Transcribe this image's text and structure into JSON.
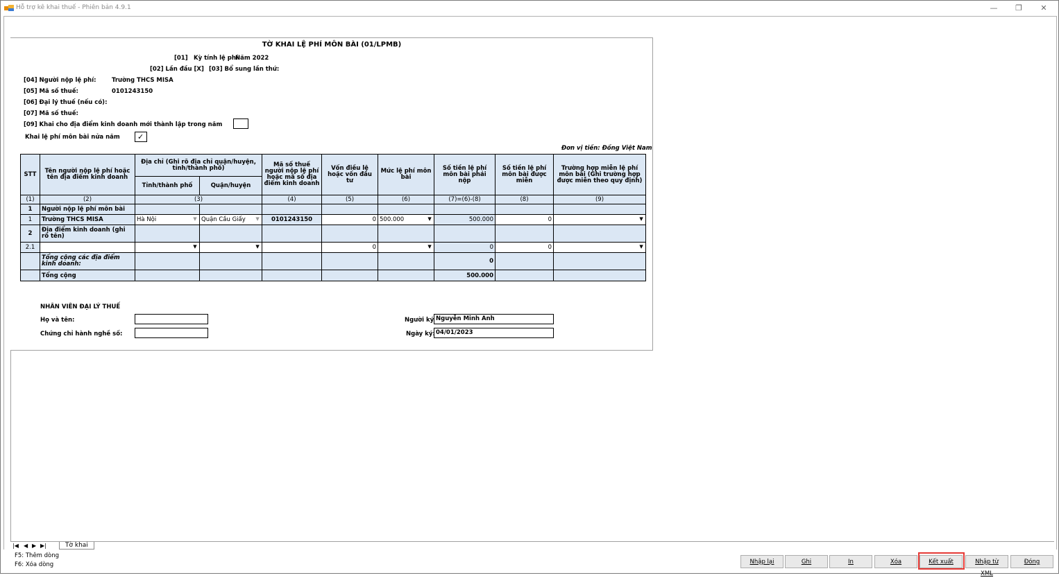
{
  "window": {
    "title": "Hỗ trợ kê khai thuế - Phiên bản 4.9.1",
    "minimize": "—",
    "restore": "❐",
    "close": "✕"
  },
  "form": {
    "title": "TỜ KHAI LỆ PHÍ MÔN BÀI (01/LPMB)",
    "period_code": "[01]",
    "period_label": "Kỳ tính lệ phí:",
    "period_value": "Năm 2022",
    "first_time": "[02] Lần đầu [X]",
    "supplement": "[03] Bổ sung lần thứ:",
    "payer_label": "[04] Người nộp lệ phí:",
    "payer_value": "Trường THCS MISA",
    "tax_code_label": "[05] Mã số thuế:",
    "tax_code_value": "0101243150",
    "agent_label": "[06] Đại lý thuế (nếu có):",
    "agent_tax_label": "[07] Mã số thuế:",
    "new_location_label": "[09] Khai cho địa điểm kinh doanh mới thành lập trong năm",
    "half_year_label": "Khai lệ phí môn bài nửa năm",
    "currency_note": "Đơn vị tiền: Đồng Việt Nam"
  },
  "table": {
    "headers": {
      "stt": "STT",
      "name": "Tên người nộp lệ phí hoặc tên địa điểm kinh doanh",
      "address": "Địa chỉ (Ghi rõ địa chỉ quận/huyện, tỉnh/thành phố)",
      "province": "Tỉnh/thành phố",
      "district": "Quận/huyện",
      "taxcode": "Mã số thuế người nộp lệ phí hoặc mã số địa điểm kinh doanh",
      "capital": "Vốn điều lệ hoặc vốn đầu tư",
      "fee_level": "Mức lệ phí môn bài",
      "payable": "Số tiền lệ phí môn bài phải nộp",
      "exempt": "Số tiền lệ phí môn bài được miễn",
      "exempt_case": "Trường hợp miễn lệ phí môn bài (Ghi trường hợp được miễn theo quy định)"
    },
    "index_row": [
      "(1)",
      "(2)",
      "(3)",
      "(4)",
      "(5)",
      "(6)",
      "(7)=(6)-(8)",
      "(8)",
      "(9)"
    ],
    "section1_no": "1",
    "section1_label": "Người nộp lệ phí môn bài",
    "row1": {
      "no": "1",
      "name": "Trường THCS MISA",
      "province": "Hà Nội",
      "district": "Quận Cầu Giấy",
      "taxcode": "0101243150",
      "capital": "0",
      "fee_level": "500.000",
      "payable": "500.000",
      "exempt": "0",
      "exempt_case": ""
    },
    "section2_no": "2",
    "section2_label": "Địa điểm kinh doanh (ghi rõ tên)",
    "row21": {
      "no": "2.1",
      "capital": "0",
      "payable": "0",
      "exempt": "0"
    },
    "subtotal_label": "Tổng cộng các địa điểm kinh doanh:",
    "subtotal_value": "0",
    "total_label": "Tổng cộng",
    "total_value": "500.000"
  },
  "agent_staff": {
    "heading": "NHÂN VIÊN ĐẠI LÝ THUẾ",
    "name_label": "Họ và tên:",
    "cert_label": "Chứng chỉ hành nghề số:",
    "signer_label": "Người ký:",
    "signer_value": "Nguyễn Minh Anh",
    "date_label": "Ngày ký:",
    "date_value": "04/01/2023"
  },
  "sheet_tab": "Tờ khai",
  "hints": {
    "f5": "F5: Thêm dòng",
    "f6": "F6: Xóa dòng"
  },
  "buttons": {
    "reset": "Nhập lại",
    "save": "Ghi",
    "print": "In",
    "delete": "Xóa",
    "export": "Kết xuất",
    "import_xml": "Nhập từ XML",
    "close": "Đóng"
  }
}
